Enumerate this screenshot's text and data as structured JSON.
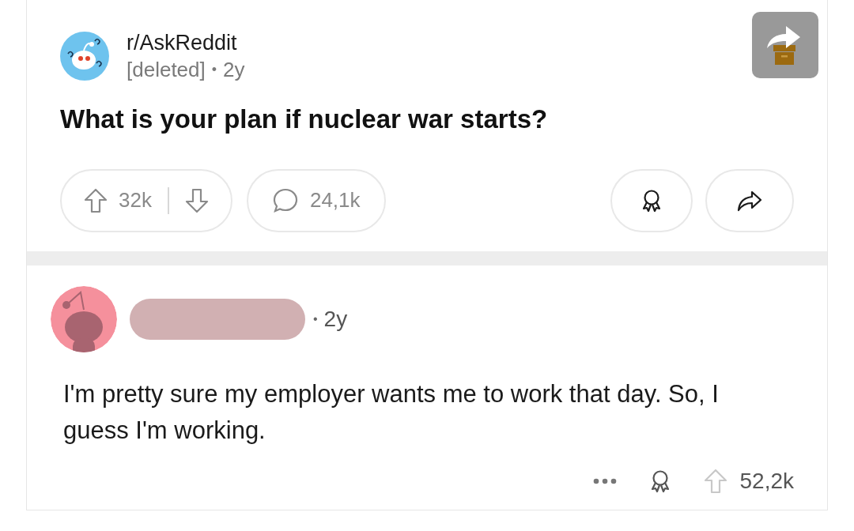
{
  "post": {
    "subreddit": "r/AskReddit",
    "author": "[deleted]",
    "separator": "•",
    "age": "2y",
    "title": "What is your plan if nuclear war starts?",
    "upvotes": "32k",
    "comments": "24,1k"
  },
  "comment": {
    "separator": "•",
    "age": "2y",
    "body": "I'm pretty sure my employer wants me to work that day. So, I guess I'm working.",
    "upvotes": "52,2k"
  }
}
